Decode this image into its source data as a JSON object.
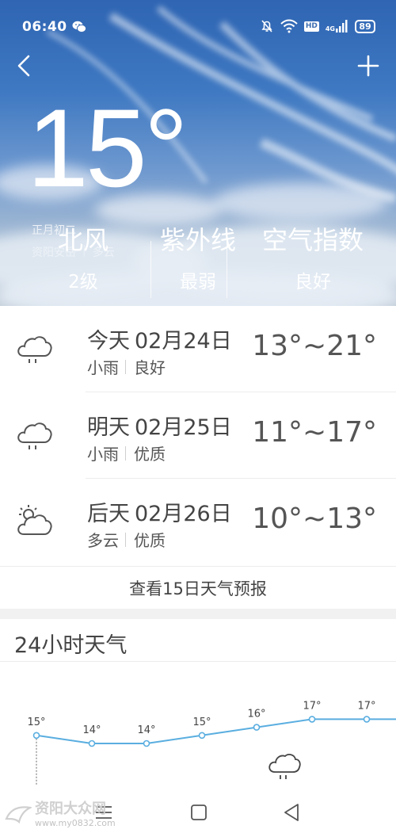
{
  "status_bar": {
    "time": "06:40",
    "battery": "89",
    "network": "4G",
    "hd": "HD"
  },
  "current": {
    "temperature": "15°",
    "lunar_date": "正月初二",
    "location": "资阳安岳",
    "condition": "多云"
  },
  "metrics": [
    {
      "label": "北风",
      "value": "2级"
    },
    {
      "label": "紫外线",
      "value": "最弱"
    },
    {
      "label": "空气指数",
      "value": "良好"
    }
  ],
  "forecast": [
    {
      "day": "今天",
      "date": "02月24日",
      "weather": "小雨",
      "air": "良好",
      "range": "13°~21°",
      "icon": "rain-cloud-icon"
    },
    {
      "day": "明天",
      "date": "02月25日",
      "weather": "小雨",
      "air": "优质",
      "range": "11°~17°",
      "icon": "rain-cloud-icon"
    },
    {
      "day": "后天",
      "date": "02月26日",
      "weather": "多云",
      "air": "优质",
      "range": "10°~13°",
      "icon": "partly-cloudy-icon"
    }
  ],
  "more_link": "查看15日天气预报",
  "hourly": {
    "title": "24小时天气"
  },
  "chart_data": {
    "type": "line",
    "title": "24小时天气",
    "x": [
      1,
      2,
      3,
      4,
      5,
      6,
      7,
      8
    ],
    "values": [
      15,
      14,
      14,
      15,
      16,
      17,
      17,
      17
    ],
    "point_labels": [
      "15°",
      "14°",
      "14°",
      "15°",
      "16°",
      "17°",
      "17°",
      ""
    ],
    "line_color": "#5aaee0",
    "grid": false
  },
  "watermark": {
    "title": "资阳大众网",
    "url": "www.my0832.com"
  },
  "colors": {
    "accent": "#5aaee0",
    "sky_top": "#2f65b3",
    "sky_bottom": "#b9c6d3"
  }
}
